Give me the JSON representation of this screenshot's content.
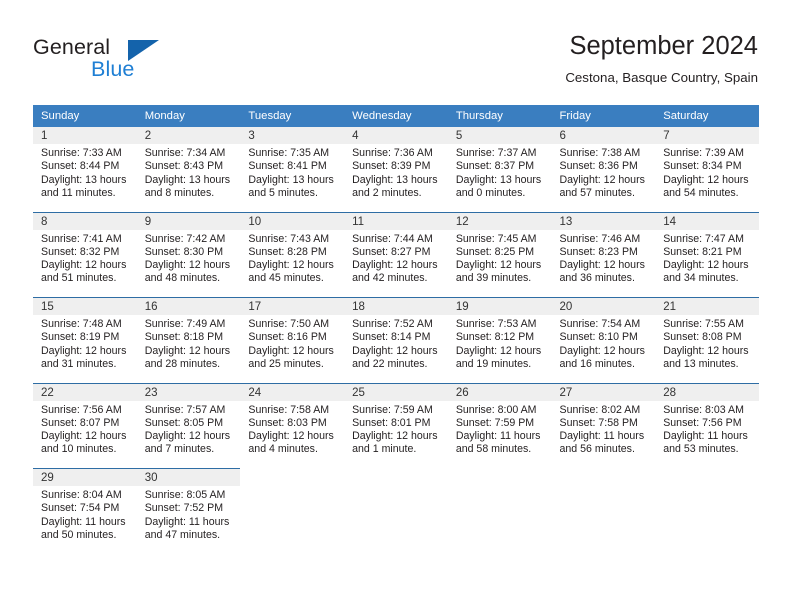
{
  "logo": {
    "word_one": "General",
    "word_two": "Blue",
    "triangle_icon": "triangle-icon",
    "accent_dark": "#1463ab",
    "accent_light": "#1f7fd4"
  },
  "header": {
    "title": "September 2024",
    "subtitle": "Cestona, Basque Country, Spain"
  },
  "calendar": {
    "header_bg": "#3a7ec0",
    "daynum_bg": "#efefef",
    "rule_color": "#2e6da4",
    "weekday_headers": [
      "Sunday",
      "Monday",
      "Tuesday",
      "Wednesday",
      "Thursday",
      "Friday",
      "Saturday"
    ],
    "weeks": [
      {
        "days": [
          {
            "num": "1",
            "sunrise": "Sunrise: 7:33 AM",
            "sunset": "Sunset: 8:44 PM",
            "daylight": "Daylight: 13 hours and 11 minutes."
          },
          {
            "num": "2",
            "sunrise": "Sunrise: 7:34 AM",
            "sunset": "Sunset: 8:43 PM",
            "daylight": "Daylight: 13 hours and 8 minutes."
          },
          {
            "num": "3",
            "sunrise": "Sunrise: 7:35 AM",
            "sunset": "Sunset: 8:41 PM",
            "daylight": "Daylight: 13 hours and 5 minutes."
          },
          {
            "num": "4",
            "sunrise": "Sunrise: 7:36 AM",
            "sunset": "Sunset: 8:39 PM",
            "daylight": "Daylight: 13 hours and 2 minutes."
          },
          {
            "num": "5",
            "sunrise": "Sunrise: 7:37 AM",
            "sunset": "Sunset: 8:37 PM",
            "daylight": "Daylight: 13 hours and 0 minutes."
          },
          {
            "num": "6",
            "sunrise": "Sunrise: 7:38 AM",
            "sunset": "Sunset: 8:36 PM",
            "daylight": "Daylight: 12 hours and 57 minutes."
          },
          {
            "num": "7",
            "sunrise": "Sunrise: 7:39 AM",
            "sunset": "Sunset: 8:34 PM",
            "daylight": "Daylight: 12 hours and 54 minutes."
          }
        ]
      },
      {
        "days": [
          {
            "num": "8",
            "sunrise": "Sunrise: 7:41 AM",
            "sunset": "Sunset: 8:32 PM",
            "daylight": "Daylight: 12 hours and 51 minutes."
          },
          {
            "num": "9",
            "sunrise": "Sunrise: 7:42 AM",
            "sunset": "Sunset: 8:30 PM",
            "daylight": "Daylight: 12 hours and 48 minutes."
          },
          {
            "num": "10",
            "sunrise": "Sunrise: 7:43 AM",
            "sunset": "Sunset: 8:28 PM",
            "daylight": "Daylight: 12 hours and 45 minutes."
          },
          {
            "num": "11",
            "sunrise": "Sunrise: 7:44 AM",
            "sunset": "Sunset: 8:27 PM",
            "daylight": "Daylight: 12 hours and 42 minutes."
          },
          {
            "num": "12",
            "sunrise": "Sunrise: 7:45 AM",
            "sunset": "Sunset: 8:25 PM",
            "daylight": "Daylight: 12 hours and 39 minutes."
          },
          {
            "num": "13",
            "sunrise": "Sunrise: 7:46 AM",
            "sunset": "Sunset: 8:23 PM",
            "daylight": "Daylight: 12 hours and 36 minutes."
          },
          {
            "num": "14",
            "sunrise": "Sunrise: 7:47 AM",
            "sunset": "Sunset: 8:21 PM",
            "daylight": "Daylight: 12 hours and 34 minutes."
          }
        ]
      },
      {
        "days": [
          {
            "num": "15",
            "sunrise": "Sunrise: 7:48 AM",
            "sunset": "Sunset: 8:19 PM",
            "daylight": "Daylight: 12 hours and 31 minutes."
          },
          {
            "num": "16",
            "sunrise": "Sunrise: 7:49 AM",
            "sunset": "Sunset: 8:18 PM",
            "daylight": "Daylight: 12 hours and 28 minutes."
          },
          {
            "num": "17",
            "sunrise": "Sunrise: 7:50 AM",
            "sunset": "Sunset: 8:16 PM",
            "daylight": "Daylight: 12 hours and 25 minutes."
          },
          {
            "num": "18",
            "sunrise": "Sunrise: 7:52 AM",
            "sunset": "Sunset: 8:14 PM",
            "daylight": "Daylight: 12 hours and 22 minutes."
          },
          {
            "num": "19",
            "sunrise": "Sunrise: 7:53 AM",
            "sunset": "Sunset: 8:12 PM",
            "daylight": "Daylight: 12 hours and 19 minutes."
          },
          {
            "num": "20",
            "sunrise": "Sunrise: 7:54 AM",
            "sunset": "Sunset: 8:10 PM",
            "daylight": "Daylight: 12 hours and 16 minutes."
          },
          {
            "num": "21",
            "sunrise": "Sunrise: 7:55 AM",
            "sunset": "Sunset: 8:08 PM",
            "daylight": "Daylight: 12 hours and 13 minutes."
          }
        ]
      },
      {
        "days": [
          {
            "num": "22",
            "sunrise": "Sunrise: 7:56 AM",
            "sunset": "Sunset: 8:07 PM",
            "daylight": "Daylight: 12 hours and 10 minutes."
          },
          {
            "num": "23",
            "sunrise": "Sunrise: 7:57 AM",
            "sunset": "Sunset: 8:05 PM",
            "daylight": "Daylight: 12 hours and 7 minutes."
          },
          {
            "num": "24",
            "sunrise": "Sunrise: 7:58 AM",
            "sunset": "Sunset: 8:03 PM",
            "daylight": "Daylight: 12 hours and 4 minutes."
          },
          {
            "num": "25",
            "sunrise": "Sunrise: 7:59 AM",
            "sunset": "Sunset: 8:01 PM",
            "daylight": "Daylight: 12 hours and 1 minute."
          },
          {
            "num": "26",
            "sunrise": "Sunrise: 8:00 AM",
            "sunset": "Sunset: 7:59 PM",
            "daylight": "Daylight: 11 hours and 58 minutes."
          },
          {
            "num": "27",
            "sunrise": "Sunrise: 8:02 AM",
            "sunset": "Sunset: 7:58 PM",
            "daylight": "Daylight: 11 hours and 56 minutes."
          },
          {
            "num": "28",
            "sunrise": "Sunrise: 8:03 AM",
            "sunset": "Sunset: 7:56 PM",
            "daylight": "Daylight: 11 hours and 53 minutes."
          }
        ]
      },
      {
        "days": [
          {
            "num": "29",
            "sunrise": "Sunrise: 8:04 AM",
            "sunset": "Sunset: 7:54 PM",
            "daylight": "Daylight: 11 hours and 50 minutes."
          },
          {
            "num": "30",
            "sunrise": "Sunrise: 8:05 AM",
            "sunset": "Sunset: 7:52 PM",
            "daylight": "Daylight: 11 hours and 47 minutes."
          },
          {
            "num": "",
            "sunrise": "",
            "sunset": "",
            "daylight": ""
          },
          {
            "num": "",
            "sunrise": "",
            "sunset": "",
            "daylight": ""
          },
          {
            "num": "",
            "sunrise": "",
            "sunset": "",
            "daylight": ""
          },
          {
            "num": "",
            "sunrise": "",
            "sunset": "",
            "daylight": ""
          },
          {
            "num": "",
            "sunrise": "",
            "sunset": "",
            "daylight": ""
          }
        ]
      }
    ]
  }
}
